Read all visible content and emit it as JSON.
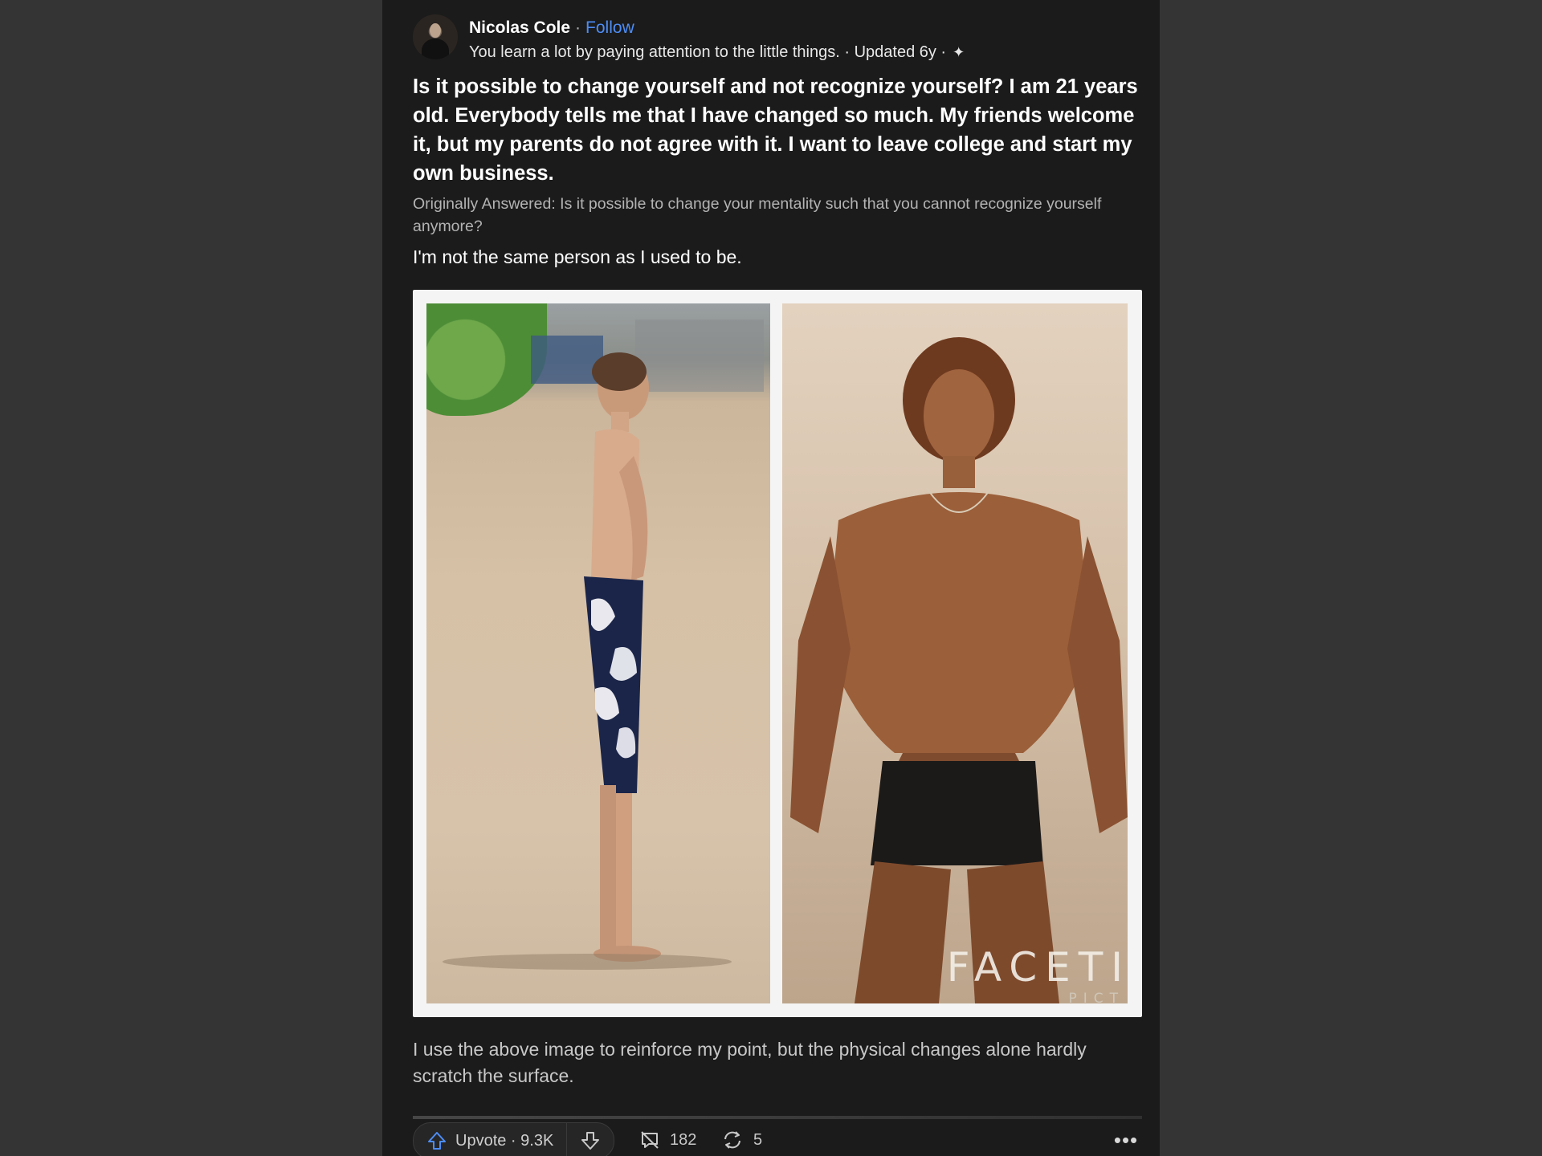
{
  "author": {
    "name": "Nicolas Cole",
    "separator": "·",
    "follow_label": "Follow",
    "credential": "You learn a lot by paying attention to the little things. · Updated 6y ·",
    "sparkle": "✦"
  },
  "question": "Is it possible to change yourself and not recognize yourself? I am 21 years old. Everybody tells me that I have changed so much. My friends welcome it, but my parents do not agree with it. I want to leave college and start my own business.",
  "originally_answered": "Originally Answered: Is it possible to change your mentality such that you cannot recognize yourself anymore?",
  "lead": "I'm not the same person as I used to be.",
  "image": {
    "watermark": "FACETI",
    "watermark_sub": "PICT"
  },
  "body": "I use the above image to reinforce my point, but the physical changes alone hardly scratch the surface.",
  "actions": {
    "upvote_label": "Upvote · 9.3K",
    "comments": "182",
    "shares": "5",
    "more": "•••",
    "colors": {
      "upvote_icon": "#4d8df6",
      "link": "#4d8df6"
    }
  }
}
